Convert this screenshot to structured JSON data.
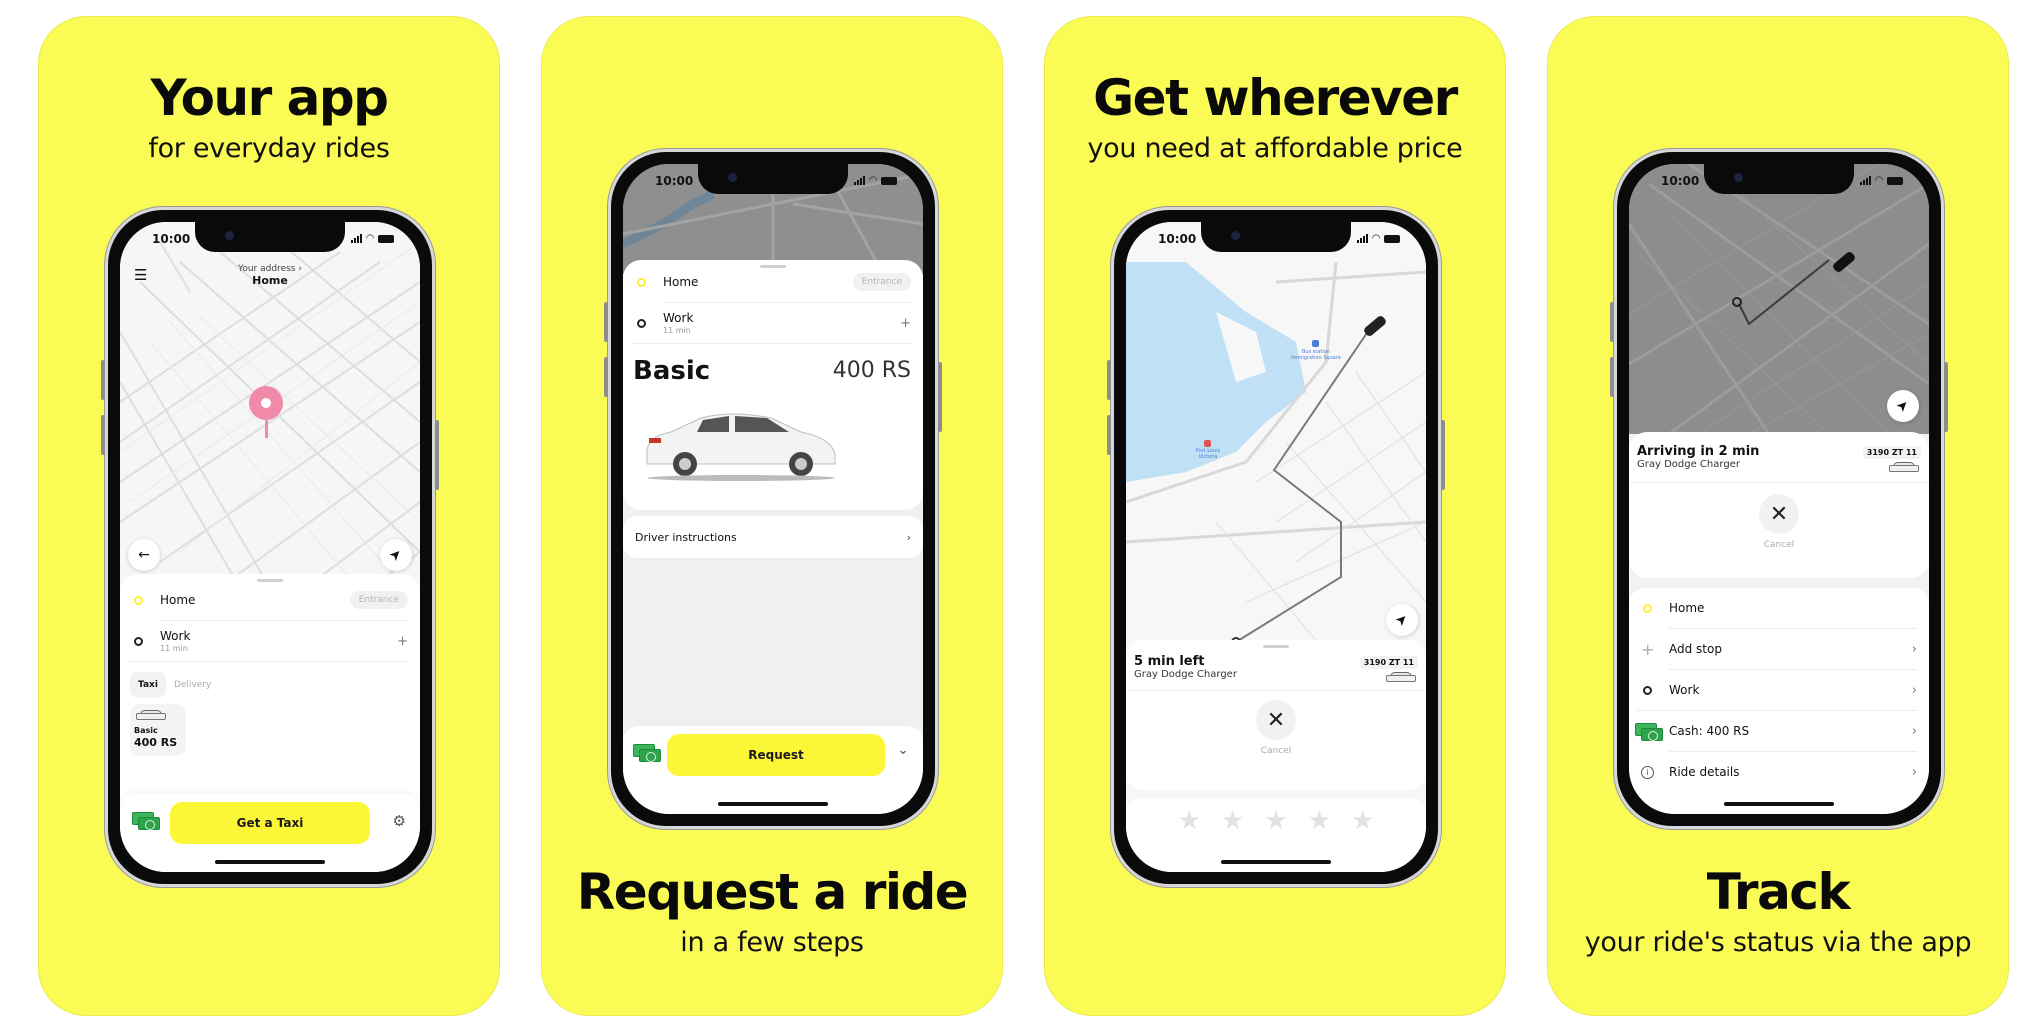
{
  "colors": {
    "brand_yellow": "#fafc55",
    "button_yellow": "#fcf736",
    "home_dot": "#fff035",
    "pin_pink": "#f08aa8",
    "water": "#bfe0f5",
    "cash_green": "#3cb65a"
  },
  "status_bar": {
    "time": "10:00",
    "icons": [
      "signal-icon",
      "wifi-icon",
      "battery-icon"
    ]
  },
  "panels": [
    {
      "headline": "Your app",
      "subheadline": "for everyday rides",
      "screen": {
        "header_caption": "Your address",
        "header_title": "Home",
        "route": [
          {
            "icon": "home-dot-icon",
            "label": "Home",
            "action": "Entrance"
          },
          {
            "icon": "work-dot-icon",
            "label": "Work",
            "minor": "11 min",
            "action_icon": "plus-icon",
            "action": "+"
          }
        ],
        "tabs": [
          {
            "label": "Taxi",
            "selected": true
          },
          {
            "label": "Delivery",
            "selected": false
          }
        ],
        "tariff": {
          "name": "Basic",
          "price": "400 RS"
        },
        "cta": "Get a Taxi",
        "menu_icon": "☰",
        "back_icon": "←",
        "locate_icon": "➤",
        "settings_icon": "⚙"
      }
    },
    {
      "headline": "Request a ride",
      "subheadline": "in a few steps",
      "screen": {
        "route": [
          {
            "icon": "home-dot-icon",
            "label": "Home",
            "action": "Entrance"
          },
          {
            "icon": "work-dot-icon",
            "label": "Work",
            "minor": "11 min",
            "action": "+"
          }
        ],
        "tariff": {
          "name": "Basic",
          "price": "400 RS"
        },
        "driver_instructions": "Driver instructions",
        "chevron": "›",
        "cta": "Request",
        "expand_icon": "⌄"
      }
    },
    {
      "headline": "Get wherever",
      "subheadline": "you need at affordable price",
      "screen": {
        "map_labels": {
          "bus_station": "Bus station Immigration Square",
          "poi": "Port Louis Victoria"
        },
        "status": "5 min left",
        "car": "Gray Dodge Charger",
        "plate": "3190 ZT 11",
        "cancel": "Cancel",
        "cancel_icon": "✕",
        "rating": {
          "stars": 5,
          "selected": 0,
          "glyph": "★"
        },
        "locate_icon": "➤"
      }
    },
    {
      "headline": "Track",
      "subheadline": "your ride's status via the app",
      "screen": {
        "status": "Arriving in 2 min",
        "car": "Gray Dodge Charger",
        "plate": "3190 ZT 11",
        "cancel": "Cancel",
        "cancel_icon": "✕",
        "locate_icon": "➤",
        "items": [
          {
            "icon": "home-dot-icon",
            "label": "Home",
            "chevron": ""
          },
          {
            "icon": "plus-icon",
            "label": "Add stop",
            "chevron": "›"
          },
          {
            "icon": "work-dot-icon",
            "label": "Work",
            "chevron": "›"
          },
          {
            "icon": "cash-icon",
            "label": "Cash: 400 RS",
            "chevron": "›"
          },
          {
            "icon": "info-icon",
            "label": "Ride details",
            "chevron": "›"
          }
        ]
      }
    }
  ]
}
